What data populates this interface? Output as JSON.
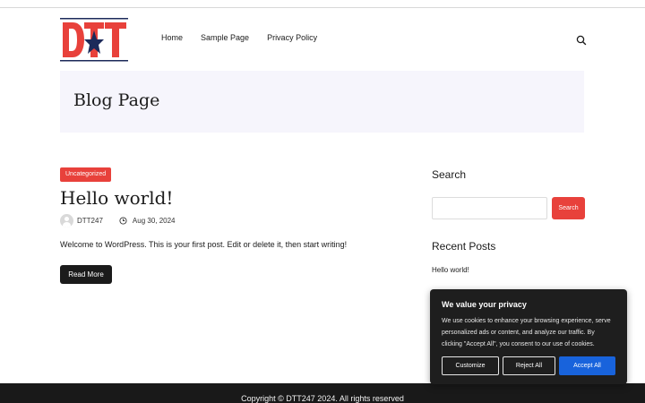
{
  "logo": {
    "text": "DTT",
    "colors": {
      "red": "#e8413b",
      "navy": "#1c2a5a"
    }
  },
  "nav": {
    "items": [
      "Home",
      "Sample Page",
      "Privacy Policy"
    ]
  },
  "header": {
    "search_icon": "search-icon"
  },
  "page_header": {
    "title": "Blog Page"
  },
  "post": {
    "category": "Uncategorized",
    "title": "Hello world!",
    "author": "DTT247",
    "date": "Aug 30, 2024",
    "excerpt": "Welcome to WordPress. This is your first post. Edit or delete it, then start writing!",
    "read_more": "Read More"
  },
  "sidebar": {
    "search_title": "Search",
    "search_input_value": "",
    "search_button": "Search",
    "recent_title": "Recent Posts",
    "recent_posts": [
      "Hello world!"
    ]
  },
  "cookie_banner": {
    "title": "We value your privacy",
    "body": "We use cookies to enhance your browsing experience, serve personalized ads or content, and analyze our traffic. By clicking \"Accept All\", you consent to our use of cookies.",
    "customize": "Customize",
    "reject": "Reject All",
    "accept": "Accept All"
  },
  "footer": {
    "copyright": "Copyright © DTT247 2024. All rights reserved"
  },
  "colors": {
    "accent": "#e8413b",
    "dark": "#1b1b1b",
    "page_header_bg": "#f6f5fc",
    "cookie_accept": "#1863dc"
  }
}
